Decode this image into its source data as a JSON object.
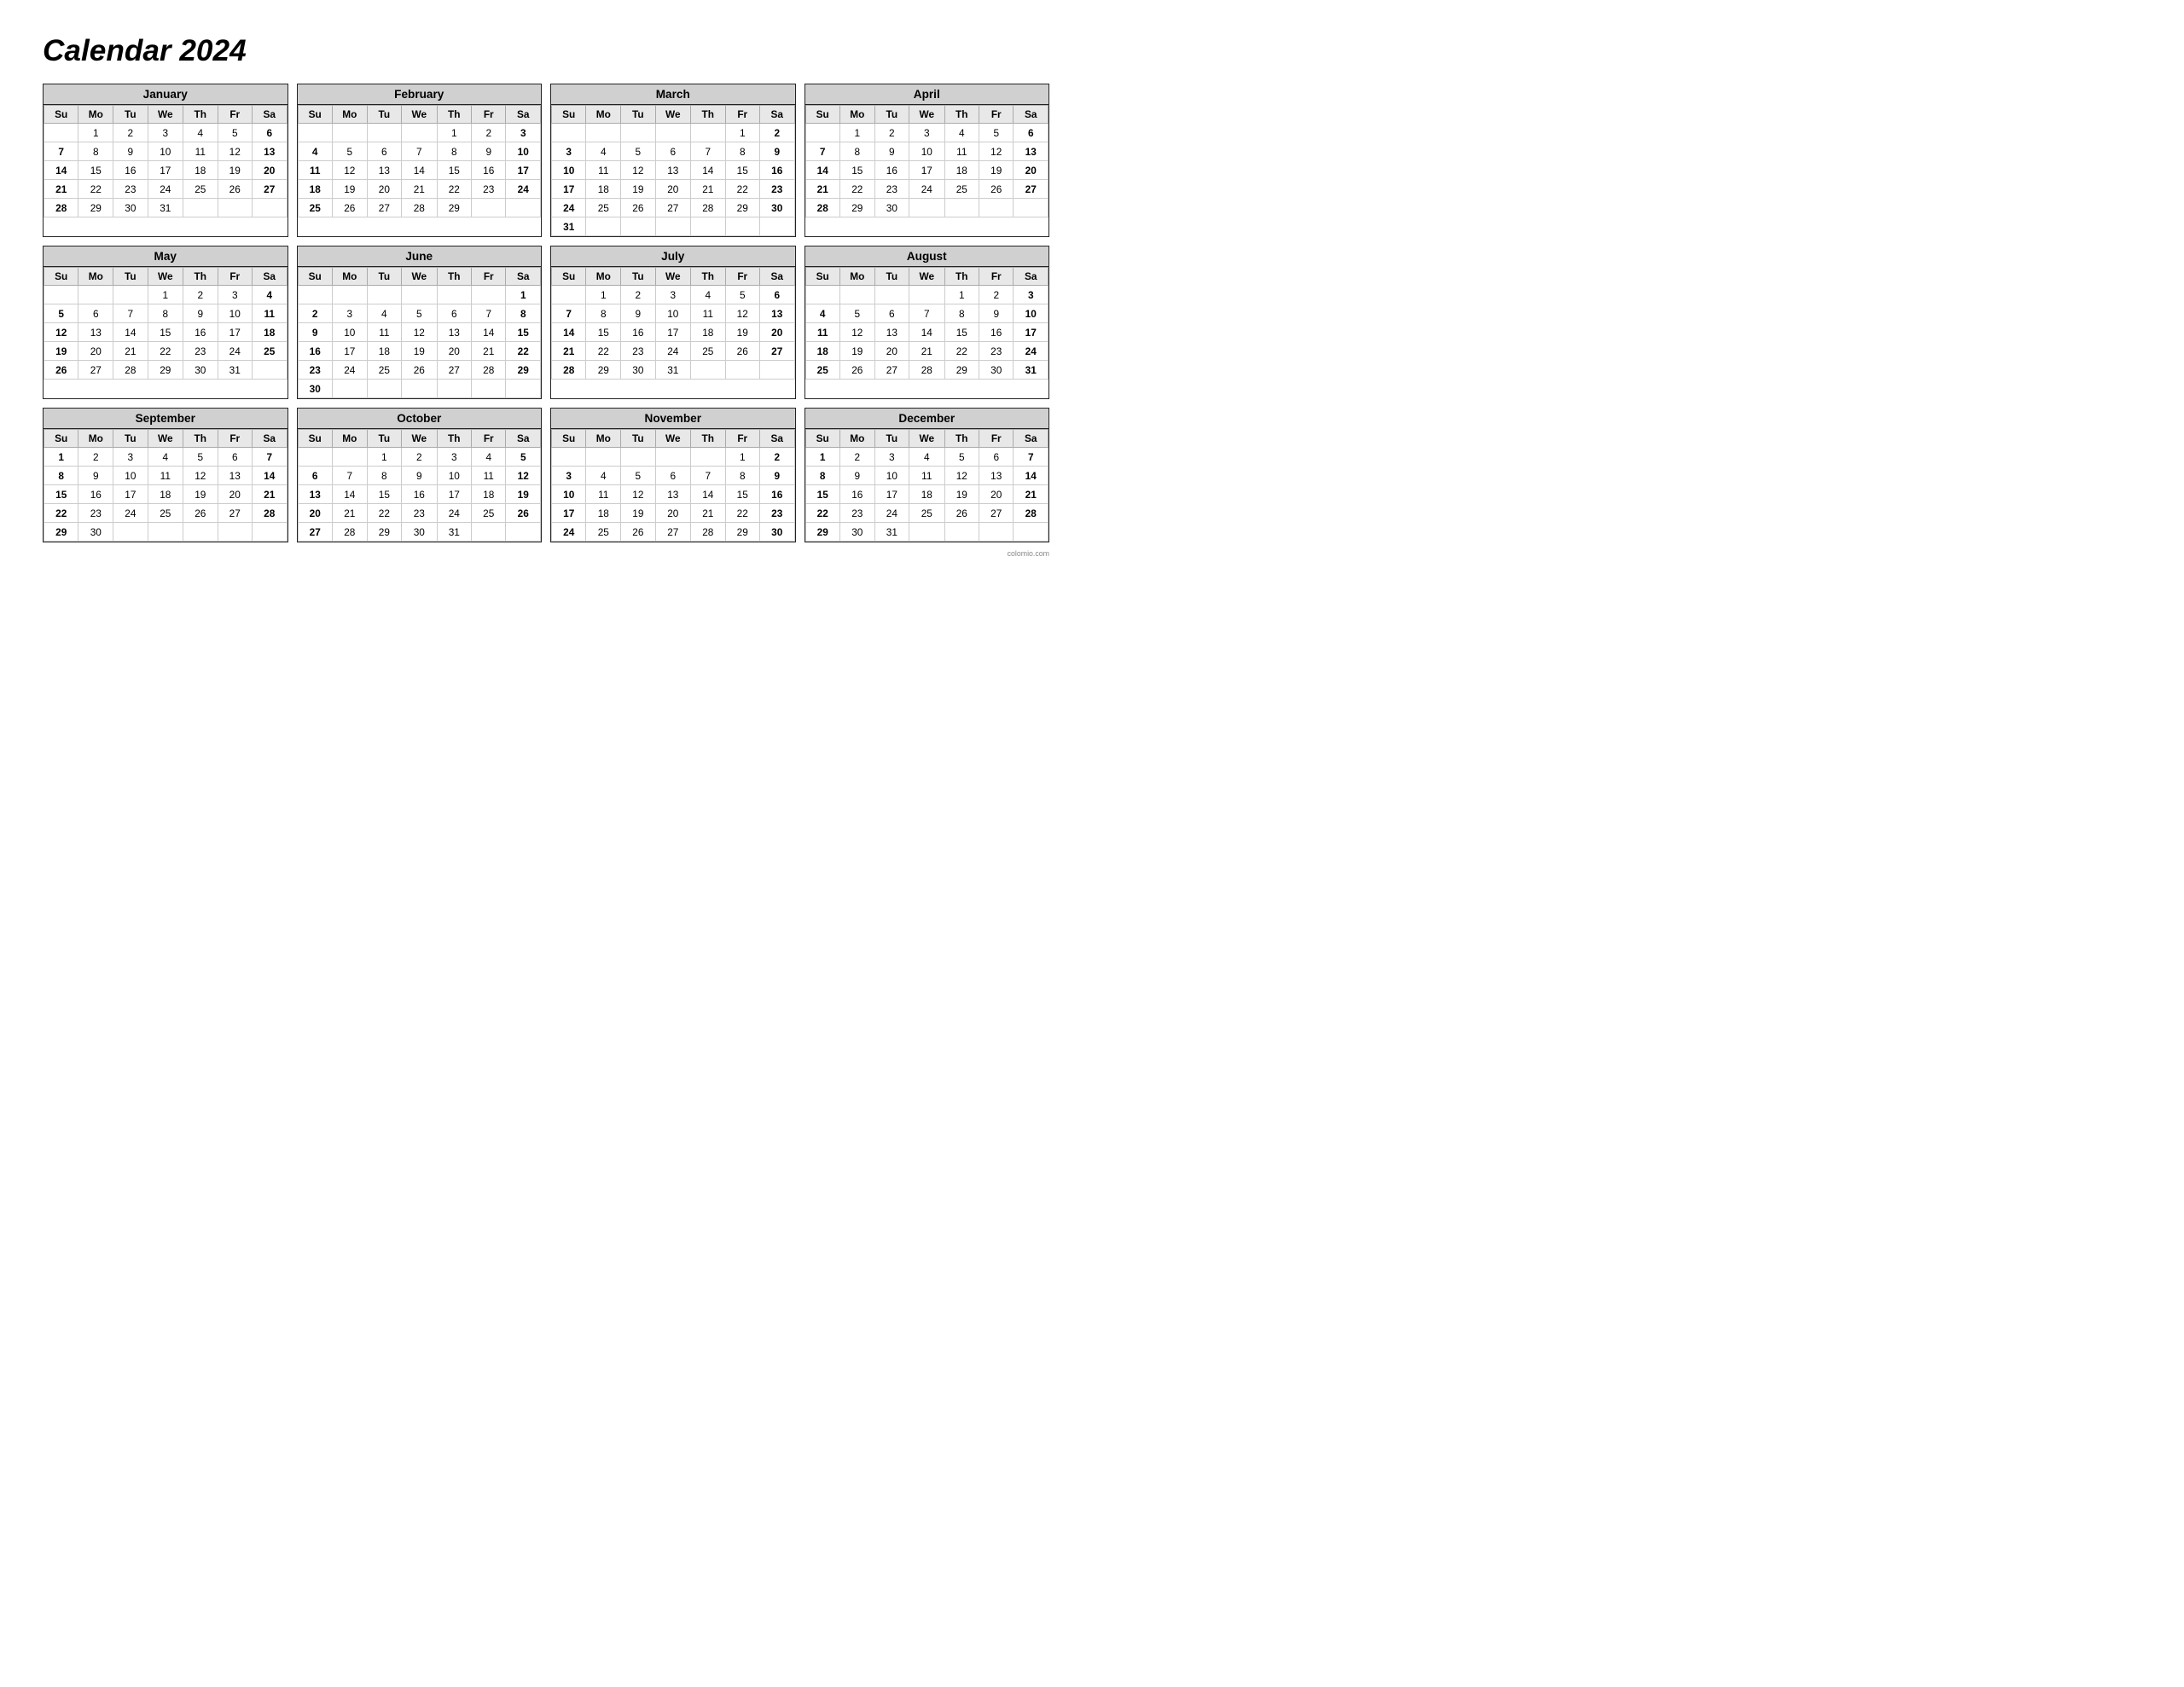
{
  "title": "Calendar 2024",
  "footer": "colomio.com",
  "months": [
    {
      "name": "January",
      "weeks": [
        [
          "",
          "1",
          "2",
          "3",
          "4",
          "5",
          "6"
        ],
        [
          "7",
          "8",
          "9",
          "10",
          "11",
          "12",
          "13"
        ],
        [
          "14",
          "15",
          "16",
          "17",
          "18",
          "19",
          "20"
        ],
        [
          "21",
          "22",
          "23",
          "24",
          "25",
          "26",
          "27"
        ],
        [
          "28",
          "29",
          "30",
          "31",
          "",
          "",
          ""
        ]
      ]
    },
    {
      "name": "February",
      "weeks": [
        [
          "",
          "",
          "",
          "",
          "1",
          "2",
          "3"
        ],
        [
          "4",
          "5",
          "6",
          "7",
          "8",
          "9",
          "10"
        ],
        [
          "11",
          "12",
          "13",
          "14",
          "15",
          "16",
          "17"
        ],
        [
          "18",
          "19",
          "20",
          "21",
          "22",
          "23",
          "24"
        ],
        [
          "25",
          "26",
          "27",
          "28",
          "29",
          "",
          ""
        ]
      ]
    },
    {
      "name": "March",
      "weeks": [
        [
          "",
          "",
          "",
          "",
          "",
          "1",
          "2"
        ],
        [
          "3",
          "4",
          "5",
          "6",
          "7",
          "8",
          "9"
        ],
        [
          "10",
          "11",
          "12",
          "13",
          "14",
          "15",
          "16"
        ],
        [
          "17",
          "18",
          "19",
          "20",
          "21",
          "22",
          "23"
        ],
        [
          "24",
          "25",
          "26",
          "27",
          "28",
          "29",
          "30"
        ],
        [
          "31",
          "",
          "",
          "",
          "",
          "",
          ""
        ]
      ]
    },
    {
      "name": "April",
      "weeks": [
        [
          "",
          "1",
          "2",
          "3",
          "4",
          "5",
          "6"
        ],
        [
          "7",
          "8",
          "9",
          "10",
          "11",
          "12",
          "13"
        ],
        [
          "14",
          "15",
          "16",
          "17",
          "18",
          "19",
          "20"
        ],
        [
          "21",
          "22",
          "23",
          "24",
          "25",
          "26",
          "27"
        ],
        [
          "28",
          "29",
          "30",
          "",
          "",
          "",
          ""
        ]
      ]
    },
    {
      "name": "May",
      "weeks": [
        [
          "",
          "",
          "",
          "1",
          "2",
          "3",
          "4"
        ],
        [
          "5",
          "6",
          "7",
          "8",
          "9",
          "10",
          "11"
        ],
        [
          "12",
          "13",
          "14",
          "15",
          "16",
          "17",
          "18"
        ],
        [
          "19",
          "20",
          "21",
          "22",
          "23",
          "24",
          "25"
        ],
        [
          "26",
          "27",
          "28",
          "29",
          "30",
          "31",
          ""
        ]
      ]
    },
    {
      "name": "June",
      "weeks": [
        [
          "",
          "",
          "",
          "",
          "",
          "",
          "1"
        ],
        [
          "2",
          "3",
          "4",
          "5",
          "6",
          "7",
          "8"
        ],
        [
          "9",
          "10",
          "11",
          "12",
          "13",
          "14",
          "15"
        ],
        [
          "16",
          "17",
          "18",
          "19",
          "20",
          "21",
          "22"
        ],
        [
          "23",
          "24",
          "25",
          "26",
          "27",
          "28",
          "29"
        ],
        [
          "30",
          "",
          "",
          "",
          "",
          "",
          ""
        ]
      ]
    },
    {
      "name": "July",
      "weeks": [
        [
          "",
          "1",
          "2",
          "3",
          "4",
          "5",
          "6"
        ],
        [
          "7",
          "8",
          "9",
          "10",
          "11",
          "12",
          "13"
        ],
        [
          "14",
          "15",
          "16",
          "17",
          "18",
          "19",
          "20"
        ],
        [
          "21",
          "22",
          "23",
          "24",
          "25",
          "26",
          "27"
        ],
        [
          "28",
          "29",
          "30",
          "31",
          "",
          "",
          ""
        ]
      ]
    },
    {
      "name": "August",
      "weeks": [
        [
          "",
          "",
          "",
          "",
          "1",
          "2",
          "3"
        ],
        [
          "4",
          "5",
          "6",
          "7",
          "8",
          "9",
          "10"
        ],
        [
          "11",
          "12",
          "13",
          "14",
          "15",
          "16",
          "17"
        ],
        [
          "18",
          "19",
          "20",
          "21",
          "22",
          "23",
          "24"
        ],
        [
          "25",
          "26",
          "27",
          "28",
          "29",
          "30",
          "31"
        ]
      ]
    },
    {
      "name": "September",
      "weeks": [
        [
          "1",
          "2",
          "3",
          "4",
          "5",
          "6",
          "7"
        ],
        [
          "8",
          "9",
          "10",
          "11",
          "12",
          "13",
          "14"
        ],
        [
          "15",
          "16",
          "17",
          "18",
          "19",
          "20",
          "21"
        ],
        [
          "22",
          "23",
          "24",
          "25",
          "26",
          "27",
          "28"
        ],
        [
          "29",
          "30",
          "",
          "",
          "",
          "",
          ""
        ]
      ]
    },
    {
      "name": "October",
      "weeks": [
        [
          "",
          "",
          "1",
          "2",
          "3",
          "4",
          "5"
        ],
        [
          "6",
          "7",
          "8",
          "9",
          "10",
          "11",
          "12"
        ],
        [
          "13",
          "14",
          "15",
          "16",
          "17",
          "18",
          "19"
        ],
        [
          "20",
          "21",
          "22",
          "23",
          "24",
          "25",
          "26"
        ],
        [
          "27",
          "28",
          "29",
          "30",
          "31",
          "",
          ""
        ]
      ]
    },
    {
      "name": "November",
      "weeks": [
        [
          "",
          "",
          "",
          "",
          "",
          "1",
          "2"
        ],
        [
          "3",
          "4",
          "5",
          "6",
          "7",
          "8",
          "9"
        ],
        [
          "10",
          "11",
          "12",
          "13",
          "14",
          "15",
          "16"
        ],
        [
          "17",
          "18",
          "19",
          "20",
          "21",
          "22",
          "23"
        ],
        [
          "24",
          "25",
          "26",
          "27",
          "28",
          "29",
          "30"
        ]
      ]
    },
    {
      "name": "December",
      "weeks": [
        [
          "1",
          "2",
          "3",
          "4",
          "5",
          "6",
          "7"
        ],
        [
          "8",
          "9",
          "10",
          "11",
          "12",
          "13",
          "14"
        ],
        [
          "15",
          "16",
          "17",
          "18",
          "19",
          "20",
          "21"
        ],
        [
          "22",
          "23",
          "24",
          "25",
          "26",
          "27",
          "28"
        ],
        [
          "29",
          "30",
          "31",
          "",
          "",
          "",
          ""
        ]
      ]
    }
  ],
  "day_headers": [
    "Su",
    "Mo",
    "Tu",
    "We",
    "Th",
    "Fr",
    "Sa"
  ]
}
